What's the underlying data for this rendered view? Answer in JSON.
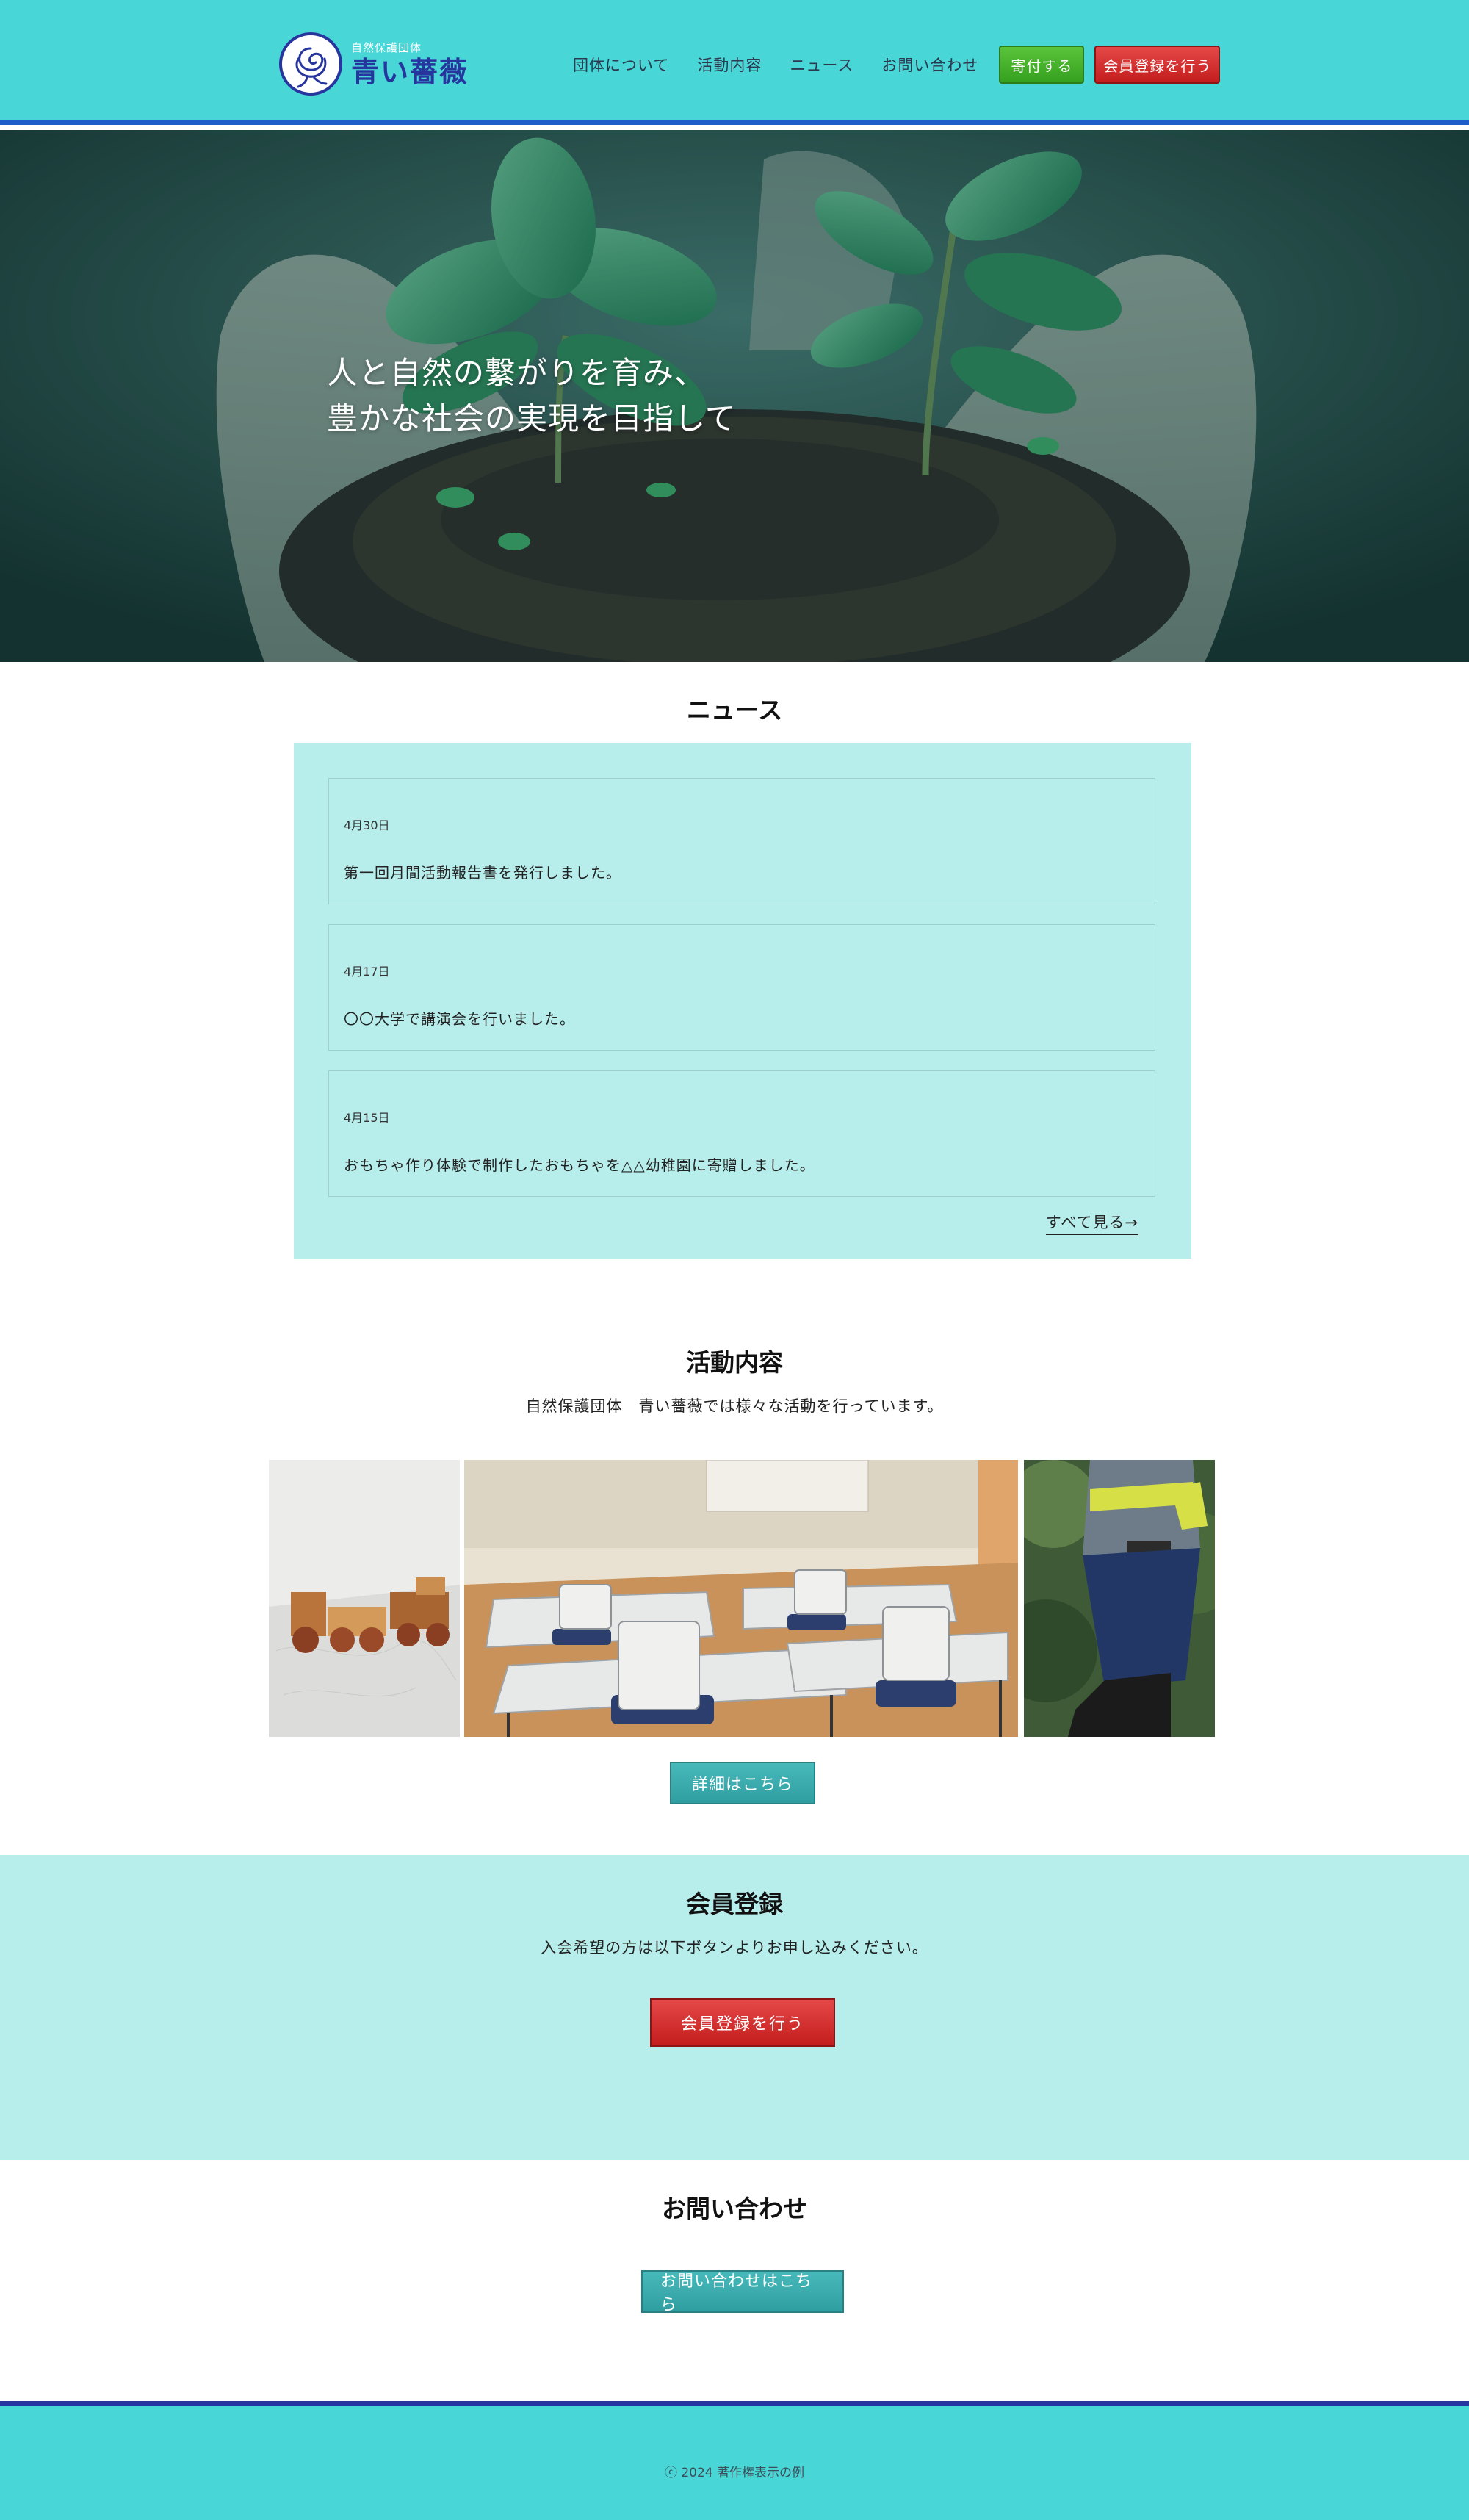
{
  "header": {
    "logo_sub": "自然保護団体",
    "logo_main": "青い薔薇",
    "nav": [
      {
        "label": "団体について"
      },
      {
        "label": "活動内容"
      },
      {
        "label": "ニュース"
      },
      {
        "label": "お問い合わせ"
      }
    ],
    "donate_label": "寄付する",
    "join_label": "会員登録を行う",
    "colors": {
      "bar": "#48d6d6",
      "accent": "#1e5cc8",
      "logo": "#27359e"
    }
  },
  "hero": {
    "line1": "人と自然の繋がりを育み、",
    "line2": "豊かな社会の実現を目指して"
  },
  "news": {
    "title": "ニュース",
    "items": [
      {
        "date": "4月30日",
        "text": "第一回月間活動報告書を発行しました。"
      },
      {
        "date": "4月17日",
        "text": "〇〇大学で講演会を行いました。"
      },
      {
        "date": "4月15日",
        "text": "おもちゃ作り体験で制作したおもちゃを△△幼稚園に寄贈しました。"
      }
    ],
    "see_all": "すべて見る→"
  },
  "activity": {
    "title": "活動内容",
    "lead": "自然保護団体　青い薔薇では様々な活動を行っています。",
    "details_button": "詳細はこちら"
  },
  "member": {
    "title": "会員登録",
    "lead": "入会希望の方は以下ボタンよりお申し込みください。",
    "button": "会員登録を行う"
  },
  "contact": {
    "title": "お問い合わせ",
    "button": "お問い合わせはこちら"
  },
  "footer": {
    "copyright": "ⓒ 2024 著作権表示の例"
  }
}
